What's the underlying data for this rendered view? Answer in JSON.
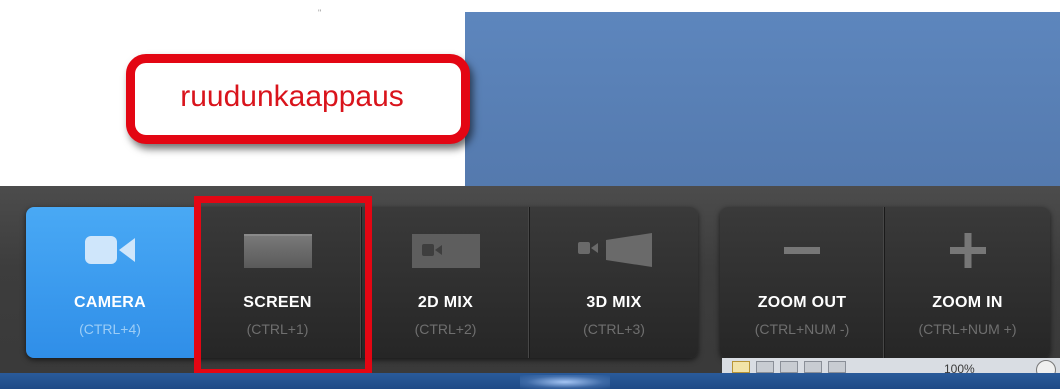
{
  "page": {
    "stray_mark": "\""
  },
  "callout": {
    "text": "ruudunkaappaus",
    "border_color": "#e30613",
    "text_color": "#d9141c"
  },
  "toolbar": {
    "capture_buttons": [
      {
        "id": "camera",
        "label": "CAMERA",
        "shortcut": "(CTRL+4)",
        "icon": "video-camera-icon",
        "active": true
      },
      {
        "id": "screen",
        "label": "SCREEN",
        "shortcut": "(CTRL+1)",
        "icon": "screen-icon",
        "active": false,
        "highlighted": true
      },
      {
        "id": "2dmix",
        "label": "2D MIX",
        "shortcut": "(CTRL+2)",
        "icon": "2d-mix-icon",
        "active": false
      },
      {
        "id": "3dmix",
        "label": "3D MIX",
        "shortcut": "(CTRL+3)",
        "icon": "3d-mix-icon",
        "active": false
      }
    ],
    "zoom_buttons": [
      {
        "id": "zoomout",
        "label": "ZOOM OUT",
        "shortcut": "(CTRL+NUM -)",
        "icon": "minus-icon"
      },
      {
        "id": "zoomin",
        "label": "ZOOM IN",
        "shortcut": "(CTRL+NUM +)",
        "icon": "plus-icon"
      }
    ],
    "colors": {
      "active_bg": "#3a9cf0",
      "toolbar_bg": "#2e2e2e",
      "highlight": "#e30613"
    }
  },
  "status_bar": {
    "zoom_text": "100%"
  }
}
